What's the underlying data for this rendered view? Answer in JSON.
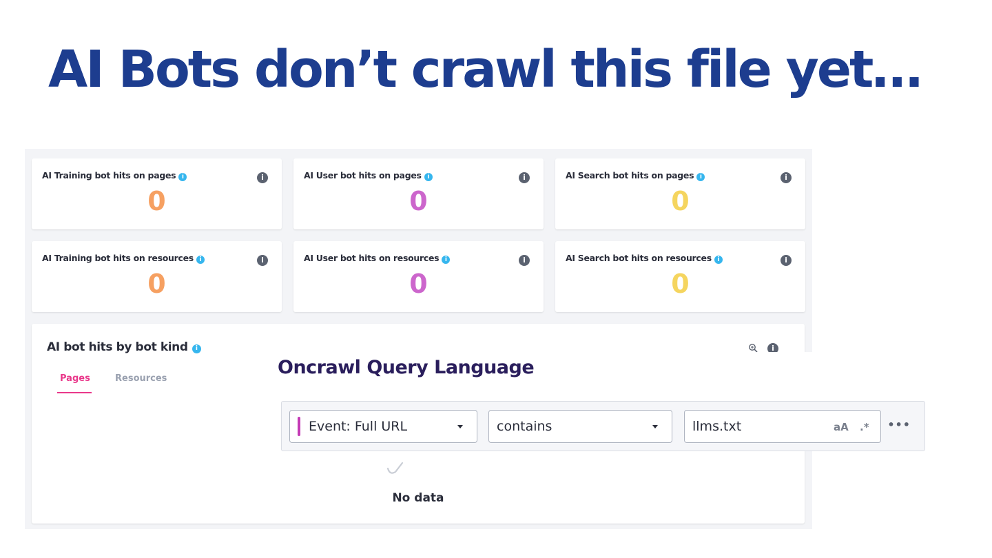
{
  "headline": "AI Bots don’t crawl this file yet…",
  "colors": {
    "headline": "#1d3d8f",
    "training": "#f6a061",
    "user": "#cc66cc",
    "search": "#f5d55f",
    "tab_active": "#e9388a",
    "info_blue": "#36b6ee"
  },
  "cards": [
    {
      "title": "AI Training bot hits on pages",
      "value": "0"
    },
    {
      "title": "AI User bot hits on pages",
      "value": "0"
    },
    {
      "title": "AI Search bot hits on pages",
      "value": "0"
    },
    {
      "title": "AI Training bot hits on resources",
      "value": "0"
    },
    {
      "title": "AI User bot hits on resources",
      "value": "0"
    },
    {
      "title": "AI Search bot hits on resources",
      "value": "0"
    }
  ],
  "panel": {
    "title": "AI bot hits by bot kind",
    "tabs": [
      "Pages",
      "Resources"
    ],
    "no_data": "No data"
  },
  "oql": {
    "title": "Oncrawl Query Language",
    "field": "Event: Full URL",
    "operator": "contains",
    "value": "llms.txt",
    "case_option": "aA",
    "regex_option": ".*",
    "more": "•••"
  },
  "icons": {
    "info": "i",
    "zoom": "zoom-in-icon",
    "no_data": "no-data-icon"
  }
}
